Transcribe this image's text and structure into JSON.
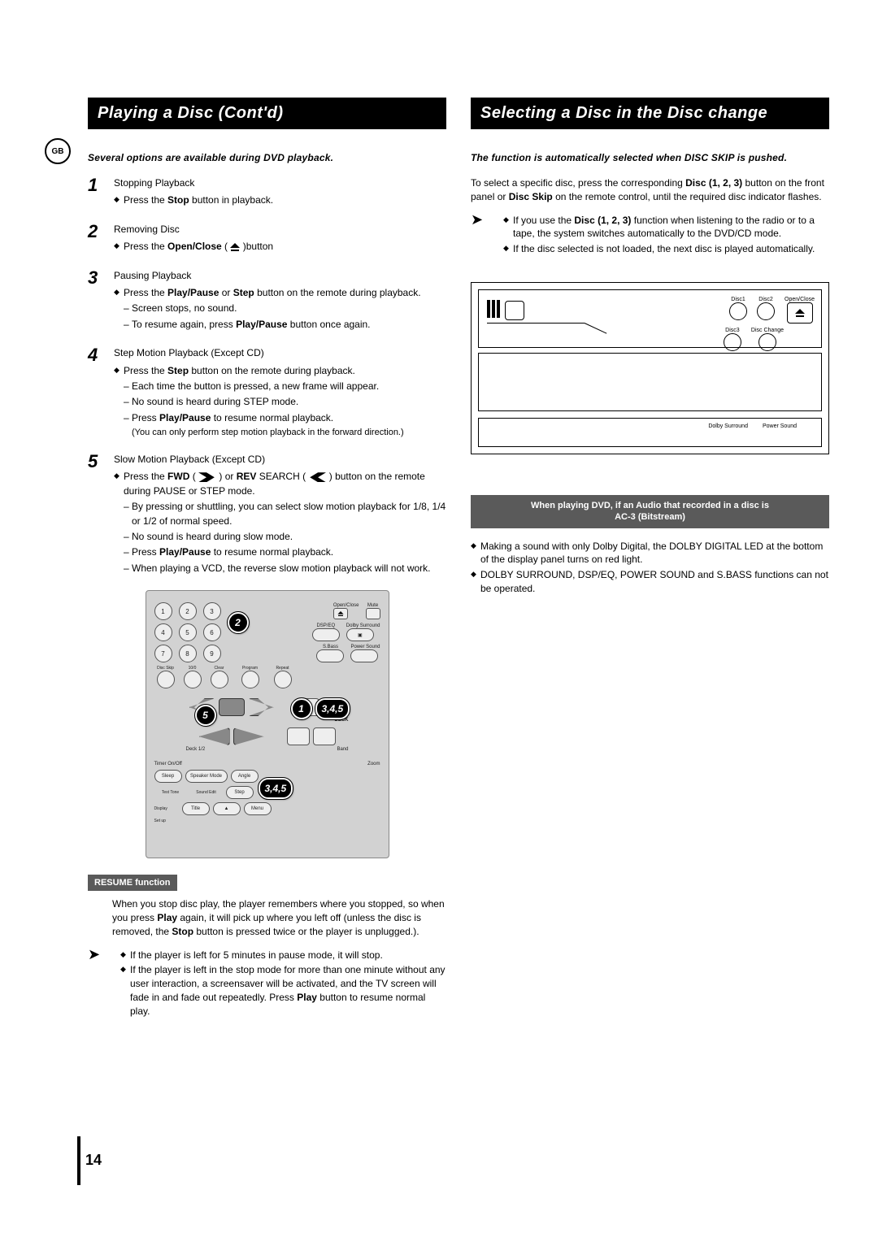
{
  "gb_badge": "GB",
  "left": {
    "title": "Playing a Disc (Cont'd)",
    "intro": "Several options are available during DVD playback.",
    "steps": [
      {
        "num": "1",
        "title": "Stopping Playback",
        "bullets": [
          "Press the Stop button in playback."
        ]
      },
      {
        "num": "2",
        "title": "Removing Disc",
        "bullets": [
          "Press the Open/Close ( ▲ )button"
        ]
      },
      {
        "num": "3",
        "title": "Pausing Playback",
        "bullets": [
          "Press the Play/Pause or Step button on the remote during playback."
        ],
        "dashes": [
          "Screen stops, no sound.",
          "To resume again, press Play/Pause button once again."
        ]
      },
      {
        "num": "4",
        "title": "Step Motion Playback (Except CD)",
        "bullets": [
          "Press the Step button on the remote during playback."
        ],
        "dashes": [
          "Each time the button is pressed, a new frame will appear.",
          "No sound is heard during STEP mode.",
          "Press Play/Pause to resume normal playback."
        ],
        "note": "(You can only perform step motion playback in the forward direction.)"
      },
      {
        "num": "5",
        "title": "Slow Motion Playback (Except CD)",
        "bullets": [
          "Press the FWD ( ▶▶ ) or REV SEARCH ( ◀◀ ) button on the remote during PAUSE or STEP mode."
        ],
        "dashes": [
          "By pressing or shuttling, you can select slow motion playback for 1/8, 1/4 or 1/2 of normal speed.",
          "No sound is heard during slow mode.",
          "Press Play/Pause to resume normal playback.",
          "When playing a VCD, the reverse slow motion playback will not work."
        ]
      }
    ],
    "remote": {
      "row1_labels": [
        "Open/Close",
        "Mute"
      ],
      "row2_labels": [
        "DSP/EQ",
        "Dolby Surround"
      ],
      "row3_labels": [
        "S.Bass",
        "Power Sound"
      ],
      "row4_labels": [
        "Disc Skip",
        "10/0",
        "Clear",
        "Program",
        "Repeat"
      ],
      "deck_label": "DECK",
      "deck12": "Deck 1/2",
      "band": "Band",
      "timer": "Timer On/Off",
      "zoom": "Zoom",
      "sleep": "Sleep",
      "speaker_mode": "Speaker Mode",
      "angle": "Angle",
      "test_tone": "Test Tone",
      "sound_edit": "Sound Edit",
      "step": "Step",
      "book_mark": "Book Mark",
      "display": "Display",
      "title": "Title",
      "menu": "Menu",
      "setup": "Set up",
      "badge2": "2",
      "badge5": "5",
      "badge1": "1",
      "badge345a": "3,4,5",
      "badge345b": "3,4,5"
    },
    "resume_label": "RESUME function",
    "resume_text": "When you stop disc play, the player remembers where you stopped, so when you press Play again, it will pick up where you left off (unless the disc is removed, the Stop button is pressed twice or the player is unplugged.).",
    "tip1": "If the player is left for 5 minutes in pause mode, it will stop.",
    "tip2": "If the player is left in the stop mode for more than one minute without any user interaction, a screensaver will be activated, and the TV screen will fade in and fade out repeatedly. Press Play button to resume normal play."
  },
  "right": {
    "title": "Selecting a Disc in the Disc change",
    "intro": "The function is automatically selected when DISC SKIP is pushed.",
    "para": "To select a specific disc, press the corresponding Disc (1, 2, 3) button on the front panel or Disc Skip on the remote control, until the required disc indicator flashes.",
    "tip1": "If you use the Disc (1, 2, 3) function when listening to the radio or to a tape, the system switches automatically to the DVD/CD mode.",
    "tip2": "If the disc selected is not loaded, the next disc is played automatically.",
    "panel": {
      "disc1": "Disc1",
      "disc2": "Disc2",
      "openclose": "Open/Close",
      "disc3": "Disc3",
      "discchange": "Disc Change",
      "dolby": "Dolby Surround",
      "power": "Power Sound"
    },
    "ac3_line1": "When playing DVD, if an Audio that recorded in a disc is",
    "ac3_line2": "AC-3 (Bitstream)",
    "ac3_b1": "Making a sound with only Dolby Digital, the DOLBY DIGITAL LED at the bottom of the display panel turns on red light.",
    "ac3_b2": "DOLBY SURROUND, DSP/EQ, POWER SOUND and S.BASS functions can not be operated."
  },
  "page_number": "14"
}
